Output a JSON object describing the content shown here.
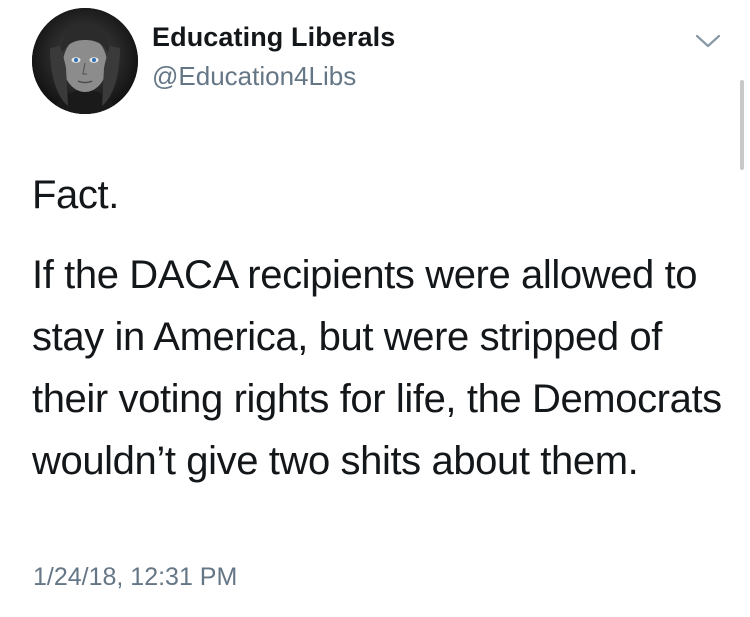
{
  "author": {
    "display_name": "Educating Liberals",
    "handle": "@Education4Libs",
    "avatar_icon": "profile-photo"
  },
  "menu": {
    "icon": "chevron-down-icon"
  },
  "tweet": {
    "line1": "Fact.",
    "line2": "If the DACA recipients were allowed to stay in America, but were stripped of their voting rights for life, the Democrats wouldn’t give two shits about them.",
    "timestamp": "1/24/18, 12:31 PM"
  },
  "colors": {
    "text": "#14171a",
    "secondary": "#657786",
    "background": "#ffffff"
  }
}
